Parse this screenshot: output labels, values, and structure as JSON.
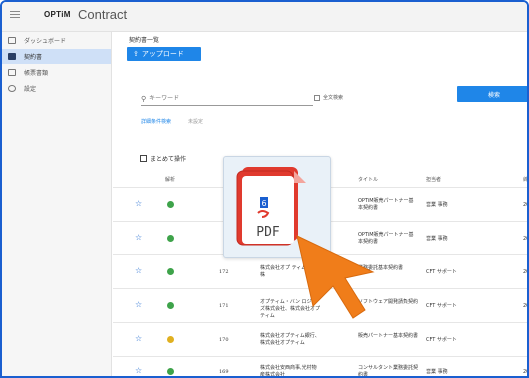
{
  "app": {
    "logo_text": "OPTiM",
    "logo_suffix": "Contract"
  },
  "sidebar": {
    "items": [
      {
        "label": "ダッシュボード",
        "icon": "dashboard-icon",
        "active": false
      },
      {
        "label": "契約書",
        "icon": "contract-icon",
        "active": true
      },
      {
        "label": "帳票書類",
        "icon": "document-icon",
        "active": false
      },
      {
        "label": "設定",
        "icon": "gear-icon",
        "active": false
      }
    ]
  },
  "main": {
    "page_title": "契約書一覧",
    "upload_label": "アップロード",
    "search": {
      "placeholder": "キーワード",
      "fulltext_label": "全文検索",
      "button_label": "検索",
      "advanced_label": "詳細条件検索",
      "advanced_status": "未設定"
    },
    "bulk_label": "まとめて操作",
    "columns": {
      "analysis": "解析",
      "title": "タイトル",
      "owner": "担当者",
      "date_prefix": "締"
    },
    "rows": [
      {
        "num": "",
        "company": "行、",
        "title": "OPTiM販売パートナー基本契約書",
        "owner": "営業 事務",
        "date": "20",
        "status": "green"
      },
      {
        "num": "",
        "company": "行、",
        "title": "OPTiM販売パートナー基本契約書",
        "owner": "営業 事務",
        "date": "20",
        "status": "green"
      },
      {
        "num": "172",
        "company": "株式会社オプ ティム商事株",
        "title": "業務委託基本契約書",
        "owner": "CFT サポート",
        "date": "20",
        "status": "green"
      },
      {
        "num": "171",
        "company": "オプティム・バン ロジーズ株式会社、株式会社オプティム",
        "title": "ソフトウェア開発請負契約書",
        "owner": "CFT サポート",
        "date": "20",
        "status": "green"
      },
      {
        "num": "170",
        "company": "株式会社オプティム銀行、株式会社オプティム",
        "title": "販売パートナー基本契約書",
        "owner": "CFT サポート",
        "date": "",
        "status": "yellow"
      },
      {
        "num": "169",
        "company": "株式会社安西商事,光村物産株式会社",
        "title": "コンサルタント業務委託契約書",
        "owner": "営業 事務",
        "date": "20",
        "status": "green"
      }
    ]
  },
  "drag_file": {
    "label": "PDF",
    "badge": "6"
  },
  "colors": {
    "accent": "#1f86e8",
    "status_green": "#3ea34a",
    "status_yellow": "#e0b020",
    "star": "#1f6ad0",
    "pdf_red": "#e03a2e",
    "cursor_orange": "#f07d1a",
    "frame_blue": "#1a5fd0"
  }
}
